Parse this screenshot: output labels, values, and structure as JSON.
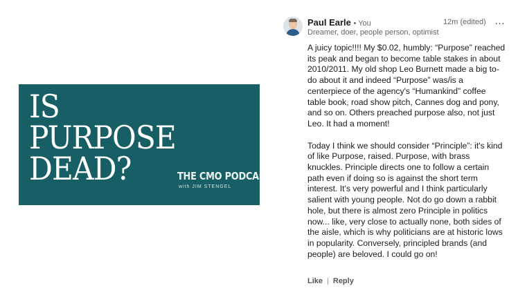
{
  "promo": {
    "headline_lines": [
      "IS",
      "PURPOSE",
      "DEAD?"
    ],
    "podcast_name": "THE CMO PODCAST",
    "host_line": "with JIM STENGEL",
    "background_color": "#175f64"
  },
  "comment": {
    "author": "Paul Earle",
    "you_badge": "• You",
    "timestamp": "12m (edited)",
    "more_icon": "…",
    "author_headline": "Dreamer, doer, people person, optimist",
    "paragraphs": [
      "A juicy topic!!!! My $0.02, humbly: “Purpose” reached its peak and began to become table stakes in about 2010/2011. My old shop Leo Burnett made a big to-do about it and indeed “Purpose” was/is a centerpiece of the agency's “Humankind” coffee table book, road show pitch, Cannes dog and pony, and so on. Others preached purpose also, not just Leo. It had a moment!",
      "Today I think we should consider “Principle”: it's kind of like Purpose, raised. Purpose, with brass knuckles. Principle directs one to follow a certain path even if doing so is against the short term interest. It's very powerful and I think particularly salient with young people. Not do go down a rabbit hole, but there is almost zero Principle in politics now... like, very close to actually none, both sides of the aisle, which is why politicians are at historic lows in popularity. Conversely, principled brands (and people) are beloved. I could go on!"
    ],
    "actions": {
      "like": "Like",
      "separator": "|",
      "reply": "Reply"
    }
  }
}
